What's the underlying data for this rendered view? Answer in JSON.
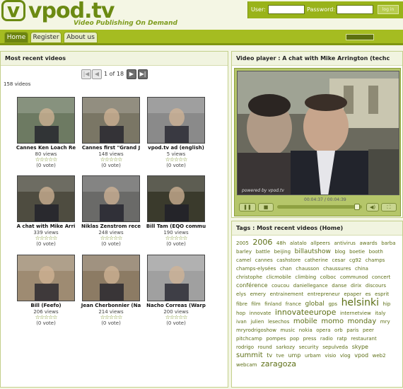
{
  "header": {
    "logo_text": "vpod.tv",
    "tagline": "Video Publishing On Demand",
    "user_label": "User:",
    "password_label": "Password:",
    "login_button": "log in"
  },
  "nav": {
    "tabs": [
      {
        "label": "Home",
        "active": true
      },
      {
        "label": "Register",
        "active": false
      },
      {
        "label": "About us",
        "active": false
      }
    ]
  },
  "left": {
    "title": "Most recent videos",
    "pager": {
      "text": "1 of 18"
    },
    "count_text": "158 videos",
    "videos": [
      {
        "title": "Cannes Ken Loach Re",
        "views": "80 views",
        "votes": "(0 vote)",
        "bg": "#6d7a62"
      },
      {
        "title": "Cannes first \"Grand J",
        "views": "148 views",
        "votes": "(0 vote)",
        "bg": "#7a7665"
      },
      {
        "title": "vpod.tv ad (english)",
        "views": "5 views",
        "votes": "(0 vote)",
        "bg": "#8a8a8a"
      },
      {
        "title": "A chat with Mike Arri",
        "views": "339 views",
        "votes": "(0 vote)",
        "bg": "#4e4c40"
      },
      {
        "title": "Niklas Zenstrom rece",
        "views": "248 views",
        "votes": "(0 vote)",
        "bg": "#6a6a68"
      },
      {
        "title": "Bill Tam (EQO commu",
        "views": "190 views",
        "votes": "(0 vote)",
        "bg": "#3a3a2c"
      },
      {
        "title": "Bill (Feefo)",
        "views": "206 views",
        "votes": "(0 vote)",
        "bg": "#9e8b72"
      },
      {
        "title": "Jean Cherbonnier (Na",
        "views": "214 views",
        "votes": "(0 vote)",
        "bg": "#8c7b64"
      },
      {
        "title": "Nacho Correas (Warp",
        "views": "200 views",
        "votes": "(0 vote)",
        "bg": "#a0a0a0"
      }
    ]
  },
  "player": {
    "title": "Video player : A chat with Mike Arrington (techc",
    "powered": "powered by vpod.tv",
    "timecode": "00:04:37 / 00:04:39",
    "progress": 0.97
  },
  "tags": {
    "title": "Tags : Most recent videos (Home)",
    "items": [
      {
        "t": "2005",
        "s": 7
      },
      {
        "t": "2006",
        "s": 11
      },
      {
        "t": "48h",
        "s": 7
      },
      {
        "t": "alatalo",
        "s": 7
      },
      {
        "t": "allpeers",
        "s": 7
      },
      {
        "t": "antivirus",
        "s": 7
      },
      {
        "t": "awards",
        "s": 7
      },
      {
        "t": "barba",
        "s": 7
      },
      {
        "t": "barley",
        "s": 7
      },
      {
        "t": "battle",
        "s": 7
      },
      {
        "t": "beijing",
        "s": 7
      },
      {
        "t": "billautshow",
        "s": 9
      },
      {
        "t": "blog",
        "s": 7
      },
      {
        "t": "boetie",
        "s": 7
      },
      {
        "t": "booth",
        "s": 7
      },
      {
        "t": "camel",
        "s": 7
      },
      {
        "t": "cannes",
        "s": 7
      },
      {
        "t": "cashstore",
        "s": 7
      },
      {
        "t": "catherine",
        "s": 7
      },
      {
        "t": "cesar",
        "s": 7
      },
      {
        "t": "cg92",
        "s": 7
      },
      {
        "t": "champs",
        "s": 7
      },
      {
        "t": "champs-elysées",
        "s": 7
      },
      {
        "t": "chan",
        "s": 7
      },
      {
        "t": "chausson",
        "s": 7
      },
      {
        "t": "chaussures",
        "s": 7
      },
      {
        "t": "china",
        "s": 7
      },
      {
        "t": "christophe",
        "s": 7
      },
      {
        "t": "clicmobile",
        "s": 7
      },
      {
        "t": "climbing",
        "s": 7
      },
      {
        "t": "colboc",
        "s": 7
      },
      {
        "t": "communod",
        "s": 7
      },
      {
        "t": "concert",
        "s": 7
      },
      {
        "t": "conférence",
        "s": 8
      },
      {
        "t": "coucou",
        "s": 7
      },
      {
        "t": "daniellegance",
        "s": 7
      },
      {
        "t": "danse",
        "s": 7
      },
      {
        "t": "dirix",
        "s": 7
      },
      {
        "t": "discours",
        "s": 7
      },
      {
        "t": "elys",
        "s": 7
      },
      {
        "t": "emery",
        "s": 7
      },
      {
        "t": "entrainement",
        "s": 7
      },
      {
        "t": "entrepreneur",
        "s": 7
      },
      {
        "t": "epaper",
        "s": 7
      },
      {
        "t": "es",
        "s": 7
      },
      {
        "t": "esprit",
        "s": 7
      },
      {
        "t": "fibre",
        "s": 7
      },
      {
        "t": "film",
        "s": 7
      },
      {
        "t": "finland",
        "s": 7
      },
      {
        "t": "france",
        "s": 7
      },
      {
        "t": "global",
        "s": 9
      },
      {
        "t": "gps",
        "s": 7
      },
      {
        "t": "helsinki",
        "s": 14
      },
      {
        "t": "hip",
        "s": 7
      },
      {
        "t": "hop",
        "s": 7
      },
      {
        "t": "innovate",
        "s": 7
      },
      {
        "t": "innovateeurope",
        "s": 11
      },
      {
        "t": "internetview",
        "s": 7
      },
      {
        "t": "italy",
        "s": 7
      },
      {
        "t": "ivan",
        "s": 7
      },
      {
        "t": "julien",
        "s": 7
      },
      {
        "t": "lesechos",
        "s": 7
      },
      {
        "t": "mobile",
        "s": 10
      },
      {
        "t": "momo",
        "s": 10
      },
      {
        "t": "monday",
        "s": 10
      },
      {
        "t": "mry",
        "s": 7
      },
      {
        "t": "mryrodrigoshow",
        "s": 7
      },
      {
        "t": "music",
        "s": 7
      },
      {
        "t": "nokia",
        "s": 7
      },
      {
        "t": "opera",
        "s": 7
      },
      {
        "t": "orb",
        "s": 7
      },
      {
        "t": "paris",
        "s": 7
      },
      {
        "t": "peer",
        "s": 7
      },
      {
        "t": "pitchcamp",
        "s": 7
      },
      {
        "t": "pompes",
        "s": 7
      },
      {
        "t": "pop",
        "s": 7
      },
      {
        "t": "press",
        "s": 7
      },
      {
        "t": "radio",
        "s": 7
      },
      {
        "t": "ratp",
        "s": 7
      },
      {
        "t": "restaurant",
        "s": 7
      },
      {
        "t": "rodrigo",
        "s": 7
      },
      {
        "t": "round",
        "s": 7
      },
      {
        "t": "sarkozy",
        "s": 7
      },
      {
        "t": "security",
        "s": 7
      },
      {
        "t": "sepulveda",
        "s": 7
      },
      {
        "t": "skype",
        "s": 8
      },
      {
        "t": "summit",
        "s": 10
      },
      {
        "t": "tv",
        "s": 8
      },
      {
        "t": "tve",
        "s": 7
      },
      {
        "t": "ump",
        "s": 8
      },
      {
        "t": "urbam",
        "s": 7
      },
      {
        "t": "visio",
        "s": 7
      },
      {
        "t": "vlog",
        "s": 7
      },
      {
        "t": "vpod",
        "s": 8
      },
      {
        "t": "web2",
        "s": 7
      },
      {
        "t": "webcam",
        "s": 7
      },
      {
        "t": "zaragoza",
        "s": 11
      }
    ]
  }
}
